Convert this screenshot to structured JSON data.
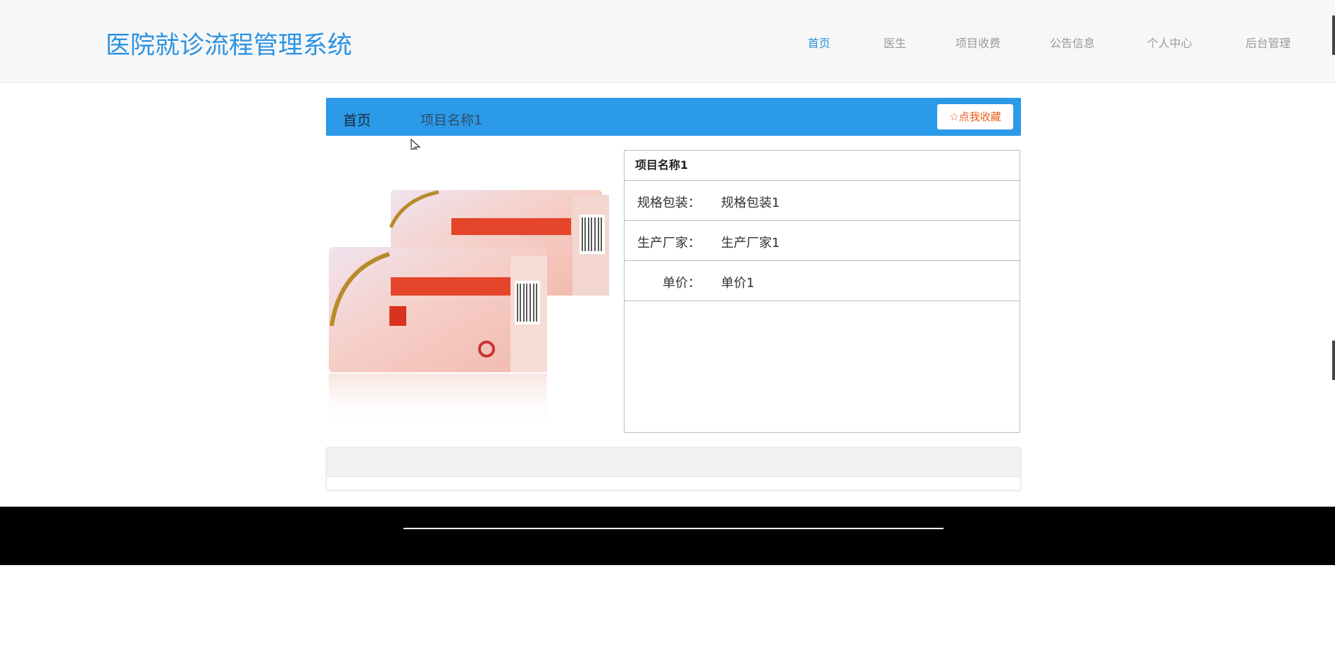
{
  "header": {
    "logo": "医院就诊流程管理系统",
    "nav": [
      "首页",
      "医生",
      "项目收费",
      "公告信息",
      "个人中心",
      "后台管理"
    ],
    "active_index": 0
  },
  "breadcrumb": {
    "home": "首页",
    "current": "项目名称1",
    "favorite_label": "点我收藏"
  },
  "product": {
    "image_alt": "盐酸雷尼替丁胶囊",
    "title": "项目名称1",
    "rows": [
      {
        "label": "规格包装：",
        "value": "规格包装1"
      },
      {
        "label": "生产厂家：",
        "value": "生产厂家1"
      },
      {
        "label": "单价：",
        "value": "单价1"
      }
    ]
  },
  "colors": {
    "accent": "#2b93e3",
    "breadcrumb_bar": "#2b9ae8",
    "favorite_text": "#e85d1a",
    "footer": "#000000"
  }
}
